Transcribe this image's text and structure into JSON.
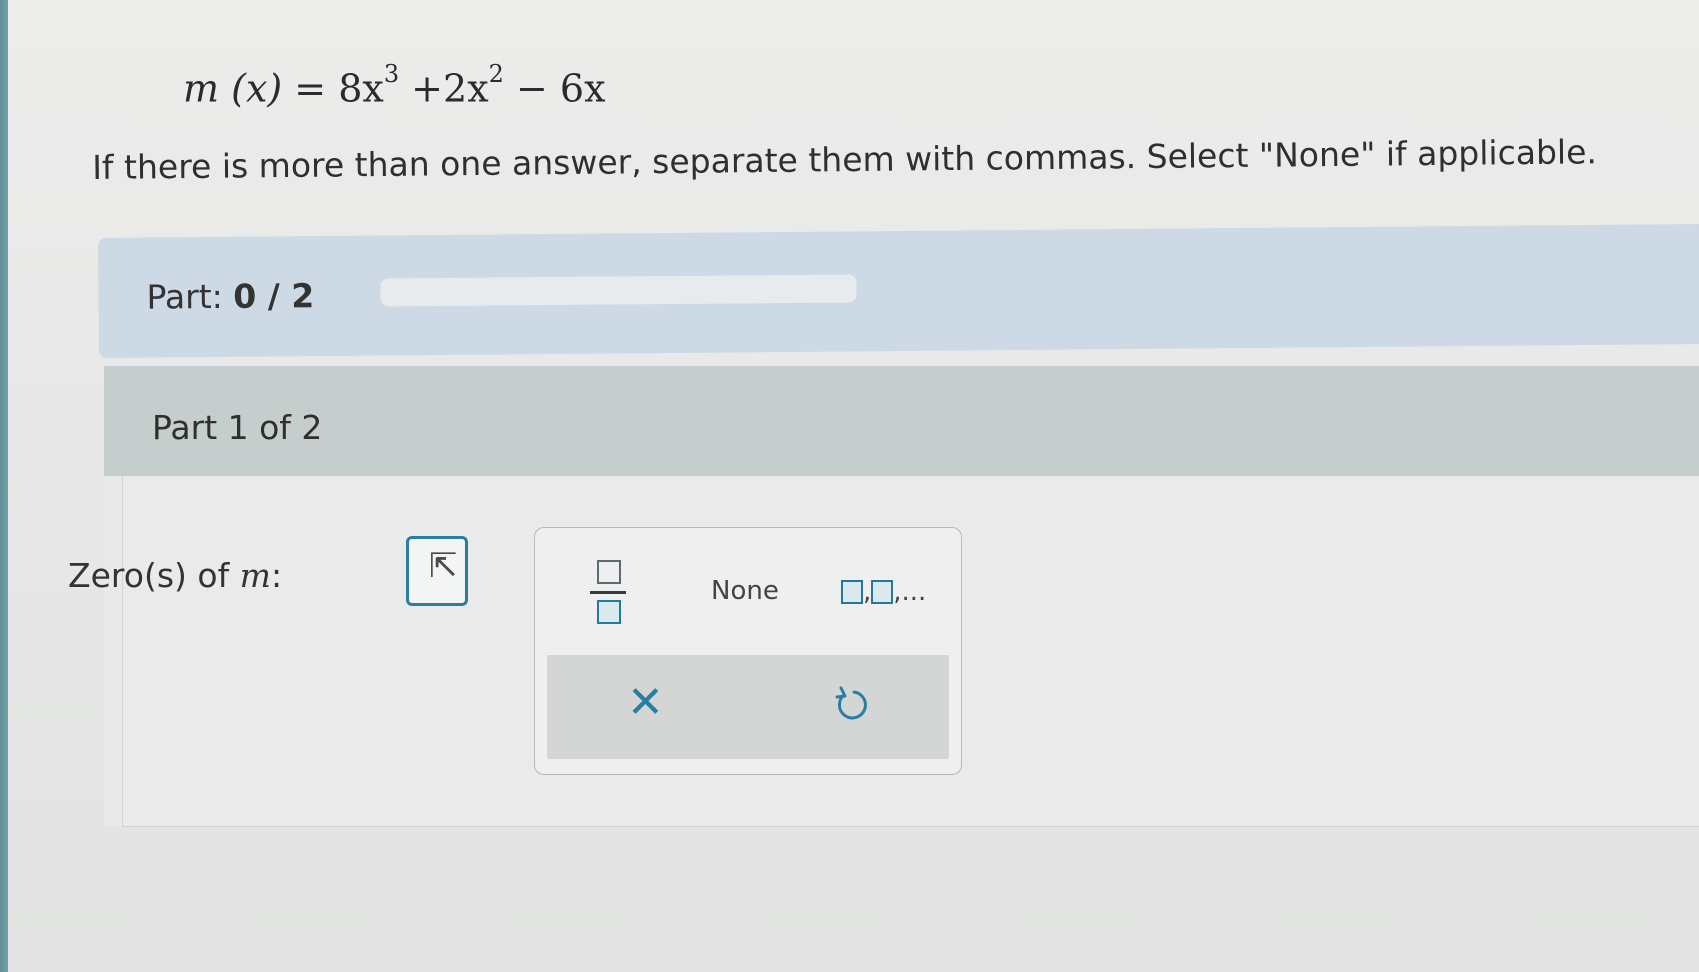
{
  "equation": {
    "lhs": "m (x) = ",
    "term1": "8x",
    "exp1": "3",
    "term2": " +2x",
    "exp2": "2",
    "term3": " − 6x"
  },
  "instructions": "If there is more than one answer, separate them with commas. Select \"None\" if applicable.",
  "part_progress": {
    "label": "Part: ",
    "value": "0 / 2",
    "fraction_complete": 0
  },
  "section": {
    "title": "Part 1 of 2",
    "zeros_label_prefix": "Zero(s) of ",
    "zeros_label_var": "m",
    "zeros_label_suffix": ":"
  },
  "keypad": {
    "none_label": "None",
    "list_label_sep": ",",
    "list_label_ellipsis": ",...",
    "clear_glyph": "✕"
  },
  "colors": {
    "accent": "#2b7ea1",
    "part_bar": "#cdd9e4",
    "section_header": "#c6cdcd"
  }
}
